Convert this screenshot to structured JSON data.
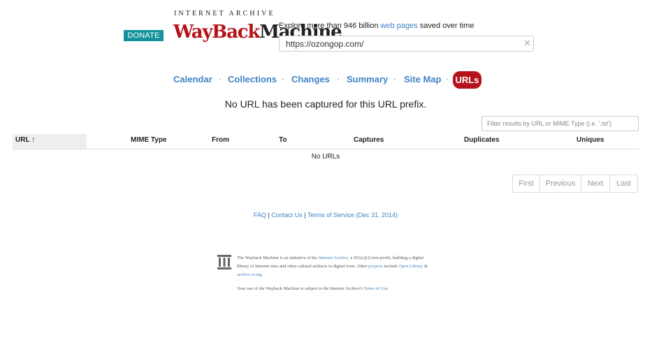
{
  "header": {
    "donate_label": "DONATE",
    "logo_top": "INTERNET ARCHIVE",
    "logo_wayback": "WayBack",
    "logo_machine": "Machine",
    "tagline_pre": "Explore more than 946 billion ",
    "tagline_link": "web pages",
    "tagline_post": " saved over time",
    "url_value": "https://ozongop.com/",
    "clear_icon": "close-icon"
  },
  "nav": {
    "items": [
      "Calendar",
      "Collections",
      "Changes",
      "Summary",
      "Site Map"
    ],
    "active": "URLs",
    "separator": "·"
  },
  "notice": "No URL has been captured for this URL prefix.",
  "filter": {
    "placeholder": "Filter results by URL or MIME Type (i.e. '.txt')"
  },
  "table": {
    "columns": [
      "URL ↑",
      "MIME Type",
      "From",
      "To",
      "Captures",
      "Duplicates",
      "Uniques"
    ],
    "empty": "No URLs"
  },
  "pagination": [
    "First",
    "Previous",
    "Next",
    "Last"
  ],
  "footer": {
    "faq": "FAQ",
    "sep": " | ",
    "contact": "Contact Us",
    "tos": "Terms of Service (Dec 31, 2014)"
  },
  "about": {
    "p1_a": "The Wayback Machine is an initiative of the ",
    "p1_link": "Internet Archive",
    "p1_b": ", a 501(c)(3) non-profit, building a digital library of Internet sites and other cultural artifacts in digital form. Other ",
    "p1_projects": "projects",
    "p1_c": " include ",
    "p1_ol": "Open Library",
    "p1_d": " & ",
    "p1_ai": "archive-it.org",
    "p1_e": ".",
    "terms_a": "Your use of the Wayback Machine is subject to the Internet Archive's ",
    "terms_link": "Terms of Use",
    "terms_b": "."
  }
}
